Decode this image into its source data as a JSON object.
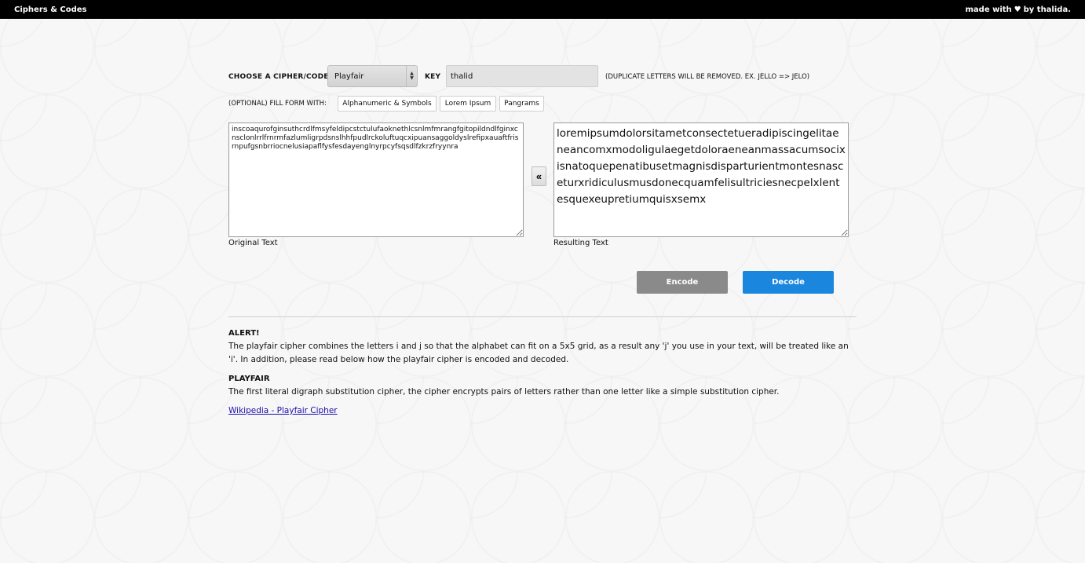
{
  "header": {
    "app_title": "Ciphers & Codes",
    "credit_prefix": "made with",
    "credit_suffix": "by thalida."
  },
  "cipher": {
    "choose_label": "CHOOSE A CIPHER/CODE",
    "selected": "Playfair",
    "key_label": "KEY",
    "key_value": "thalid",
    "duplicate_note": "(DUPLICATE LETTERS WILL BE REMOVED. EX. JELLO => JELO)"
  },
  "fill": {
    "label": "(OPTIONAL) FILL FORM WITH:",
    "options": [
      "Alphanumeric & Symbols",
      "Lorem Ipsum",
      "Pangrams"
    ]
  },
  "text": {
    "original_value": "inscoaqurofginsuthcrdlfmsyfeldipcstctulufaoknethlcsnlmfmrangfgitopildndlfginxcnsclonlrrlfrnrmfazlumligrpdsnslhhfpudlrckoluftuqcxipuansaggoldyslrefipxauaftfrisrnpufgsnbrriocnelusiapaflfysfesdayenglnyrpcyfsqsdlfzkrzfryynra",
    "result_value": "loremipsumdolorsitametconsectetueradipiscingelitaeneancomxmodoligulaegetdoloraeneanmassacumsocixisnatoquepenatibusetmagnisdisparturientmontesnasceturxridiculusmusdonecquamfelisultriciesnecpelxlentesquexeupretiumquisxsemx",
    "original_caption": "Original Text",
    "result_caption": "Resulting Text",
    "swap_symbol": "«"
  },
  "actions": {
    "encode_label": "Encode",
    "decode_label": "Decode"
  },
  "info": {
    "alert_title": "ALERT!",
    "alert_body": "The playfair cipher combines the letters i and j so that the alphabet can fit on a 5x5 grid, as a result any 'j' you use in your text, will be treated like an 'i'. In addition, please read below how the playfair cipher is encoded and decoded.",
    "playfair_title": "PLAYFAIR",
    "playfair_body": "The first literal digraph substitution cipher, the cipher encrypts pairs of letters rather than one letter like a simple substitution cipher.",
    "wiki_link": "Wikipedia - Playfair Cipher"
  },
  "colors": {
    "encode": "#8a8a8a",
    "decode": "#1a86dd",
    "topbar": "#000000"
  }
}
